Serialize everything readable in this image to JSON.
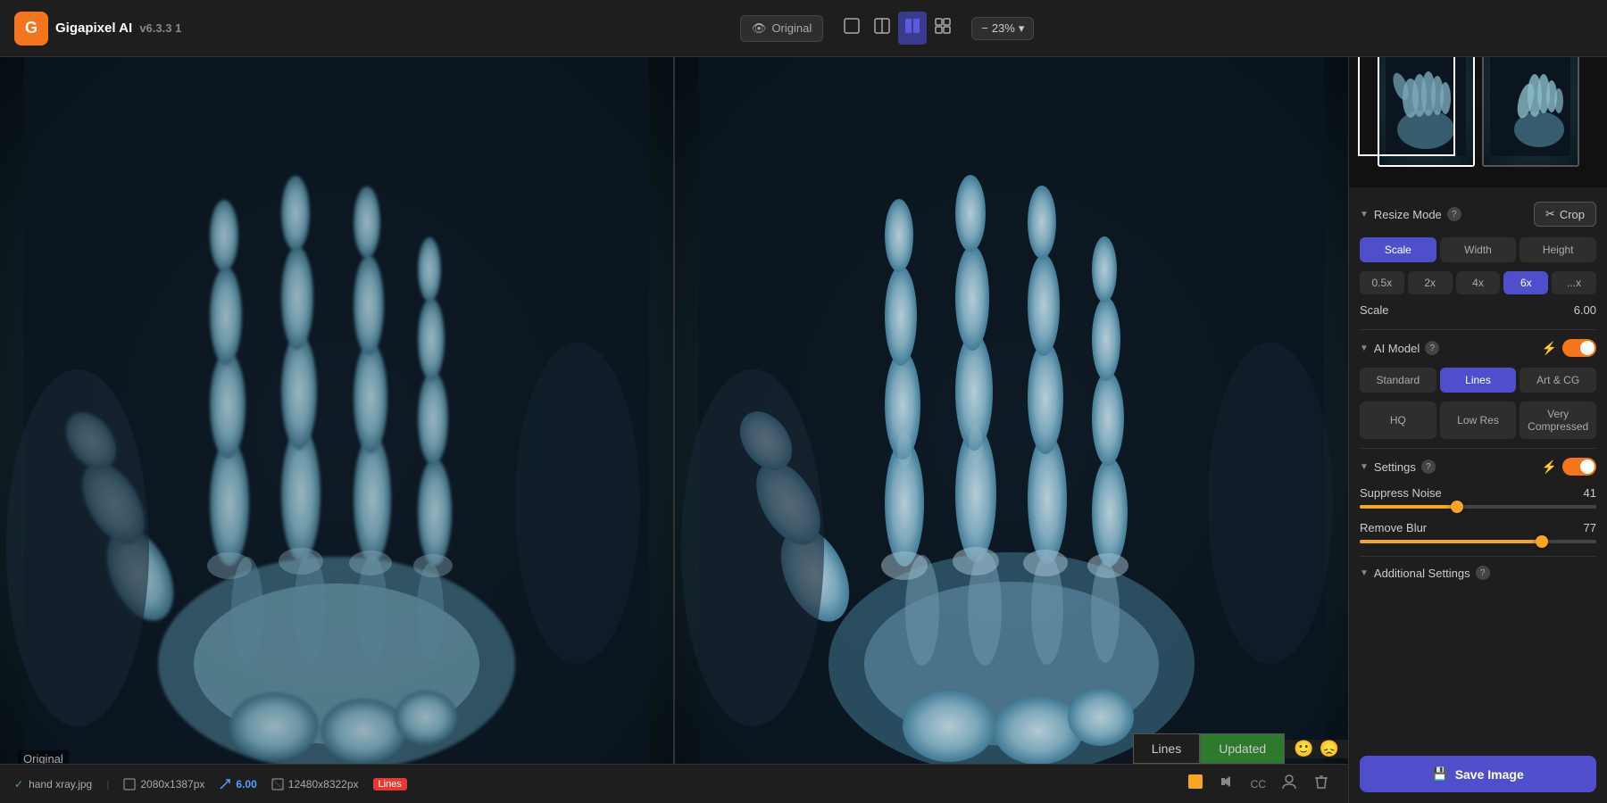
{
  "app": {
    "name": "Gigapixel AI",
    "version": "v6.3.3 1"
  },
  "header": {
    "original_btn": "Original",
    "zoom_level": "23%",
    "zoom_icon": "⊕"
  },
  "canvas": {
    "original_label": "Original",
    "split_view": true
  },
  "status_bar": {
    "filename": "hand xray.jpg",
    "original_size": "2080x1387px",
    "scale": "6.00",
    "output_size": "12480x8322px",
    "model": "Lines"
  },
  "mode_overlay": {
    "lines_label": "Lines",
    "updated_label": "Updated"
  },
  "right_panel": {
    "resize_mode": {
      "title": "Resize Mode",
      "crop_btn": "Crop",
      "scale_btn": "Scale",
      "width_btn": "Width",
      "height_btn": "Height",
      "presets": [
        "0.5x",
        "2x",
        "4x",
        "6x",
        "...x"
      ],
      "active_preset": "6x",
      "scale_label": "Scale",
      "scale_value": "6.00"
    },
    "ai_model": {
      "title": "AI Model",
      "options": [
        "Standard",
        "Lines",
        "Art & CG"
      ],
      "active": "Lines",
      "sub_options": [
        "HQ",
        "Low Res",
        "Very Compressed"
      ],
      "active_sub": ""
    },
    "settings": {
      "title": "Settings",
      "suppress_noise_label": "Suppress Noise",
      "suppress_noise_value": "41",
      "suppress_noise_pct": 41,
      "remove_blur_label": "Remove Blur",
      "remove_blur_value": "77",
      "remove_blur_pct": 77
    },
    "additional_settings": {
      "title": "Additional Settings"
    },
    "save_btn": "Save Image"
  }
}
